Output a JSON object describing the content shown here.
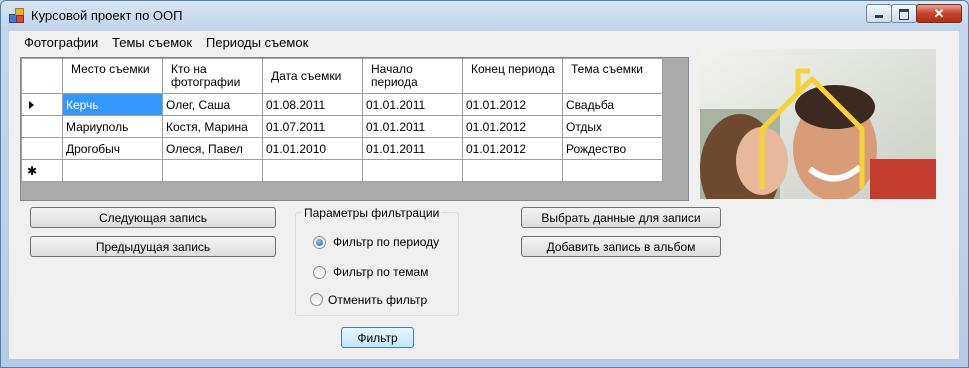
{
  "window": {
    "title": "Курсовой проект по ООП",
    "close_glyph": "✕"
  },
  "menu": [
    "Фотографии",
    "Темы съемок",
    "Периоды съемок"
  ],
  "grid": {
    "columns": [
      "Место съемки",
      "Кто на фотографии",
      "Дата съемки",
      "Начало периода",
      "Конец периода",
      "Тема съемки"
    ],
    "rows": [
      [
        "Керчь",
        "Олег, Саша",
        "01.08.2011",
        "01.01.2011",
        "01.01.2012",
        "Свадьба"
      ],
      [
        "Мариуполь",
        "Костя, Марина",
        "01.07.2011",
        "01.01.2011",
        "01.01.2012",
        "Отдых"
      ],
      [
        "Дрогобыч",
        "Олеся, Павел",
        "01.01.2010",
        "01.01.2011",
        "01.01.2012",
        "Рождество"
      ]
    ],
    "new_row_glyph": "✱",
    "selected_row": 0
  },
  "buttons": {
    "next": "Следующая запись",
    "prev": "Предыдущая запись",
    "select_data": "Выбрать данные для записи",
    "add_album": "Добавить запись в альбом",
    "filter": "Фильтр"
  },
  "filter_group": {
    "title": "Параметры фильтрации",
    "options": [
      "Фильтр по периоду",
      "Фильтр по темам",
      "Отменить фильтр"
    ],
    "selected_index": 0
  },
  "icons": {
    "app": "app-icon",
    "minimize": "minimize-icon",
    "maximize": "maximize-icon",
    "close": "close-icon",
    "row_pointer": "row-pointer-icon",
    "new_row": "new-row-icon"
  }
}
